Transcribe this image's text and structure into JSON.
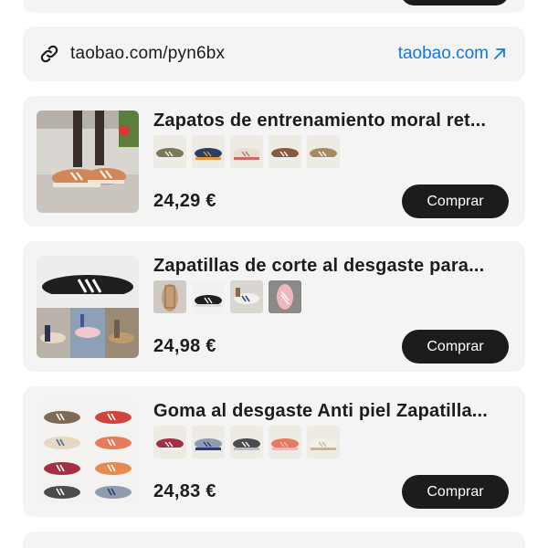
{
  "link": {
    "short_url": "taobao.com/pyn6bx",
    "domain": "taobao.com"
  },
  "colors": {
    "accent_link": "#1677d6",
    "button_bg": "#1c1c1e",
    "card_bg": "#f4f4f5"
  },
  "products": [
    {
      "title": "Zapatos de entrenamiento moral ret...",
      "price": "24,29 €",
      "button": "Comprar",
      "variants": [
        "olive-suede",
        "navy-orange",
        "cream-pink",
        "brown-suede",
        "tan-suede"
      ]
    },
    {
      "title": "Zapatillas de corte al desgaste para...",
      "price": "24,98 €",
      "button": "Comprar",
      "variants": [
        "tan-gum",
        "black-white",
        "white-blue",
        "pink-suede"
      ]
    },
    {
      "title": "Goma al desgaste Anti piel Zapatilla...",
      "price": "24,83 €",
      "button": "Comprar",
      "variants": [
        "burgundy",
        "grey-blue",
        "dark-grey",
        "orange-pink",
        "cream-white"
      ]
    }
  ],
  "icons": {
    "link": "link-icon",
    "external": "arrow-up-right-icon"
  }
}
